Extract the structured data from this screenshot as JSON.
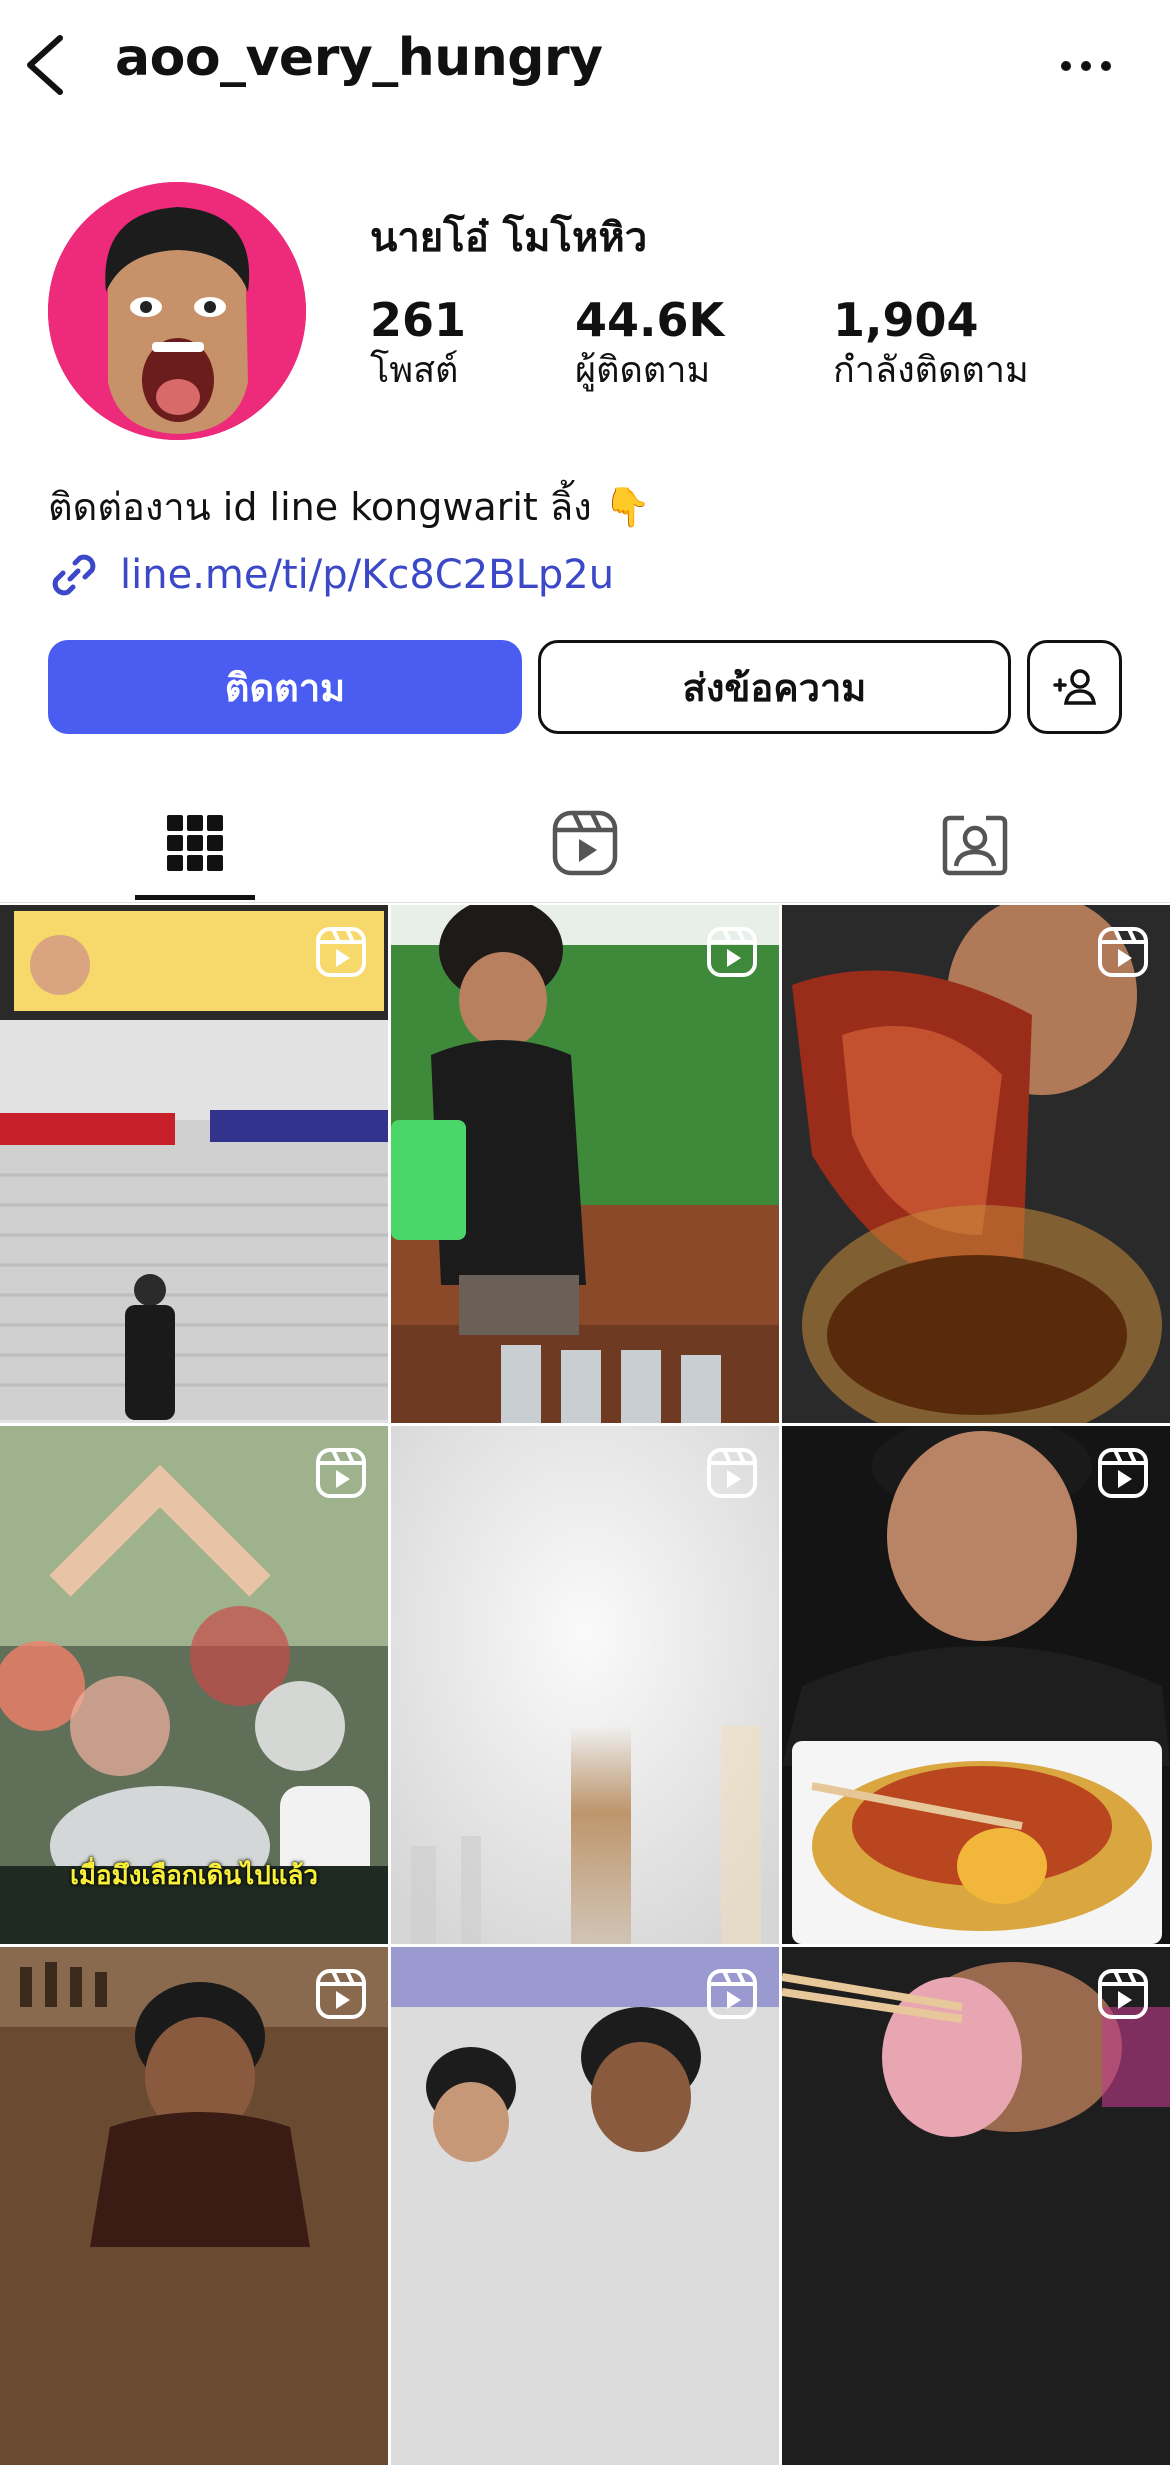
{
  "header": {
    "username": "aoo_very_hungry"
  },
  "profile": {
    "display_name": "นายโอ๋ โมโหหิว",
    "stats": [
      {
        "value": "261",
        "label": "โพสต์"
      },
      {
        "value": "44.6K",
        "label": "ผู้ติดตาม"
      },
      {
        "value": "1,904",
        "label": "กำลังติดตาม"
      }
    ],
    "bio": "ติดต่องาน id line kongwarit ลิ้ง 👇",
    "link": "line.me/ti/p/Kc8C2BLp2u"
  },
  "actions": {
    "follow_label": "ติดตาม",
    "message_label": "ส่งข้อความ"
  },
  "tabs": {
    "active": "grid",
    "items": [
      "grid-icon",
      "reels-icon",
      "tagged-icon"
    ]
  },
  "grid": {
    "tiles": [
      {
        "type": "reel"
      },
      {
        "type": "reel"
      },
      {
        "type": "reel"
      },
      {
        "type": "reel",
        "caption": "เมื่อมึงเลือกเดินไปแล้ว"
      },
      {
        "type": "reel"
      },
      {
        "type": "reel"
      },
      {
        "type": "reel"
      },
      {
        "type": "reel"
      },
      {
        "type": "reel"
      }
    ]
  },
  "colors": {
    "accent": "#4b5cf0",
    "link": "#3b48c8",
    "avatar_bg": "#ee2b7a"
  }
}
